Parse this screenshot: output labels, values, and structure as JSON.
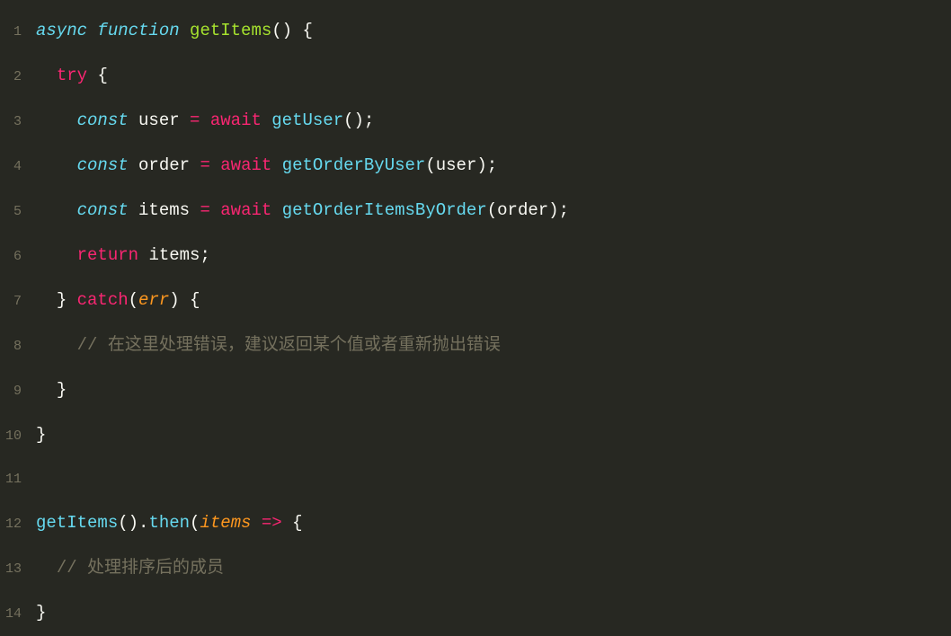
{
  "code": {
    "lines": [
      {
        "num": "1",
        "tokens": [
          {
            "t": "async",
            "c": "kw-storage"
          },
          {
            "t": " ",
            "c": ""
          },
          {
            "t": "function",
            "c": "kw-function"
          },
          {
            "t": " ",
            "c": ""
          },
          {
            "t": "getItems",
            "c": "func-name"
          },
          {
            "t": "()",
            "c": "paren"
          },
          {
            "t": " ",
            "c": ""
          },
          {
            "t": "{",
            "c": "brace"
          }
        ]
      },
      {
        "num": "2",
        "tokens": [
          {
            "t": "  ",
            "c": ""
          },
          {
            "t": "try",
            "c": "kw-control"
          },
          {
            "t": " ",
            "c": ""
          },
          {
            "t": "{",
            "c": "brace"
          }
        ]
      },
      {
        "num": "3",
        "tokens": [
          {
            "t": "    ",
            "c": ""
          },
          {
            "t": "const",
            "c": "const-kw"
          },
          {
            "t": " ",
            "c": ""
          },
          {
            "t": "user",
            "c": "variable"
          },
          {
            "t": " ",
            "c": ""
          },
          {
            "t": "=",
            "c": "operator"
          },
          {
            "t": " ",
            "c": ""
          },
          {
            "t": "await",
            "c": "await-kw"
          },
          {
            "t": " ",
            "c": ""
          },
          {
            "t": "getUser",
            "c": "func-call"
          },
          {
            "t": "()",
            "c": "paren"
          },
          {
            "t": ";",
            "c": "punctuation"
          }
        ]
      },
      {
        "num": "4",
        "tokens": [
          {
            "t": "    ",
            "c": ""
          },
          {
            "t": "const",
            "c": "const-kw"
          },
          {
            "t": " ",
            "c": ""
          },
          {
            "t": "order",
            "c": "variable"
          },
          {
            "t": " ",
            "c": ""
          },
          {
            "t": "=",
            "c": "operator"
          },
          {
            "t": " ",
            "c": ""
          },
          {
            "t": "await",
            "c": "await-kw"
          },
          {
            "t": " ",
            "c": ""
          },
          {
            "t": "getOrderByUser",
            "c": "func-call"
          },
          {
            "t": "(",
            "c": "paren"
          },
          {
            "t": "user",
            "c": "variable"
          },
          {
            "t": ")",
            "c": "paren"
          },
          {
            "t": ";",
            "c": "punctuation"
          }
        ]
      },
      {
        "num": "5",
        "tokens": [
          {
            "t": "    ",
            "c": ""
          },
          {
            "t": "const",
            "c": "const-kw"
          },
          {
            "t": " ",
            "c": ""
          },
          {
            "t": "items",
            "c": "variable"
          },
          {
            "t": " ",
            "c": ""
          },
          {
            "t": "=",
            "c": "operator"
          },
          {
            "t": " ",
            "c": ""
          },
          {
            "t": "await",
            "c": "await-kw"
          },
          {
            "t": " ",
            "c": ""
          },
          {
            "t": "getOrderItemsByOrder",
            "c": "func-call"
          },
          {
            "t": "(",
            "c": "paren"
          },
          {
            "t": "order",
            "c": "variable"
          },
          {
            "t": ")",
            "c": "paren"
          },
          {
            "t": ";",
            "c": "punctuation"
          }
        ]
      },
      {
        "num": "6",
        "tokens": [
          {
            "t": "    ",
            "c": ""
          },
          {
            "t": "return",
            "c": "kw-control"
          },
          {
            "t": " ",
            "c": ""
          },
          {
            "t": "items",
            "c": "variable"
          },
          {
            "t": ";",
            "c": "punctuation"
          }
        ]
      },
      {
        "num": "7",
        "tokens": [
          {
            "t": "  ",
            "c": ""
          },
          {
            "t": "}",
            "c": "brace"
          },
          {
            "t": " ",
            "c": ""
          },
          {
            "t": "catch",
            "c": "kw-control"
          },
          {
            "t": "(",
            "c": "paren"
          },
          {
            "t": "err",
            "c": "param"
          },
          {
            "t": ")",
            "c": "paren"
          },
          {
            "t": " ",
            "c": ""
          },
          {
            "t": "{",
            "c": "brace"
          }
        ]
      },
      {
        "num": "8",
        "tokens": [
          {
            "t": "    ",
            "c": ""
          },
          {
            "t": "// 在这里处理错误，建议返回某个值或者重新抛出错误",
            "c": "comment"
          }
        ]
      },
      {
        "num": "9",
        "tokens": [
          {
            "t": "  ",
            "c": ""
          },
          {
            "t": "}",
            "c": "brace"
          }
        ]
      },
      {
        "num": "10",
        "tokens": [
          {
            "t": "}",
            "c": "brace"
          }
        ]
      },
      {
        "num": "11",
        "tokens": []
      },
      {
        "num": "12",
        "tokens": [
          {
            "t": "getItems",
            "c": "func-call"
          },
          {
            "t": "()",
            "c": "paren"
          },
          {
            "t": ".",
            "c": "punctuation"
          },
          {
            "t": "then",
            "c": "func-call"
          },
          {
            "t": "(",
            "c": "paren"
          },
          {
            "t": "items",
            "c": "param"
          },
          {
            "t": " ",
            "c": ""
          },
          {
            "t": "=>",
            "c": "operator"
          },
          {
            "t": " ",
            "c": ""
          },
          {
            "t": "{",
            "c": "brace"
          }
        ]
      },
      {
        "num": "13",
        "tokens": [
          {
            "t": "  ",
            "c": ""
          },
          {
            "t": "// 处理排序后的成员",
            "c": "comment"
          }
        ]
      },
      {
        "num": "14",
        "tokens": [
          {
            "t": "}",
            "c": "brace"
          }
        ]
      }
    ]
  }
}
